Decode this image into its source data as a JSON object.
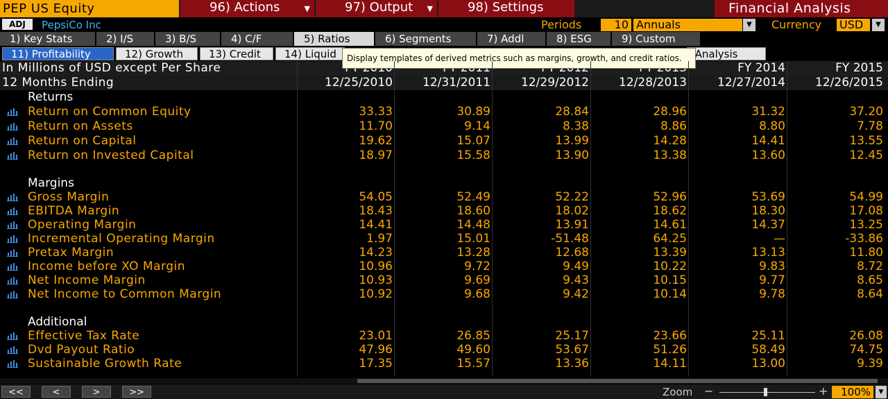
{
  "header": {
    "ticker": "PEP US Equity",
    "menu": [
      {
        "label": "96) Actions"
      },
      {
        "label": "97) Output"
      },
      {
        "label": "98) Settings"
      }
    ],
    "app_title": "Financial Analysis"
  },
  "subheader": {
    "adj": "ADJ",
    "company": "PepsiCo Inc",
    "periods_label": "Periods",
    "periods_value": "10",
    "period_type": "Annuals",
    "currency_label": "Currency",
    "currency_value": "USD"
  },
  "tabs": [
    {
      "label": "1) Key Stats"
    },
    {
      "label": "2) I/S"
    },
    {
      "label": "3) B/S"
    },
    {
      "label": "4) C/F"
    },
    {
      "label": "5) Ratios"
    },
    {
      "label": "6) Segments"
    },
    {
      "label": "7) Addl"
    },
    {
      "label": "8) ESG"
    },
    {
      "label": "9) Custom"
    }
  ],
  "subtabs": [
    {
      "label": "11) Profitability"
    },
    {
      "label": "12) Growth"
    },
    {
      "label": "13) Credit"
    },
    {
      "label": "14) Liquid"
    },
    {
      "label": "t Analysis"
    }
  ],
  "tooltip": "Display templates of derived metrics such as margins, growth, and credit ratios.",
  "table": {
    "units_label": "In Millions of USD except Per Share",
    "period_label": "12 Months Ending",
    "columns": [
      {
        "fy": "FY 2010",
        "date": "12/25/2010"
      },
      {
        "fy": "FY 2011",
        "date": "12/31/2011"
      },
      {
        "fy": "FY 2012",
        "date": "12/29/2012"
      },
      {
        "fy": "FY 2013",
        "date": "12/28/2013"
      },
      {
        "fy": "FY 2014",
        "date": "12/27/2014"
      },
      {
        "fy": "FY 2015",
        "date": "12/26/2015"
      }
    ],
    "sections": [
      {
        "title": "Returns",
        "rows": [
          {
            "label": "Return on Common Equity",
            "values": [
              "33.33",
              "30.89",
              "28.84",
              "28.96",
              "31.32",
              "37.20"
            ]
          },
          {
            "label": "Return on Assets",
            "values": [
              "11.70",
              "9.14",
              "8.38",
              "8.86",
              "8.80",
              "7.78"
            ]
          },
          {
            "label": "Return on Capital",
            "values": [
              "19.62",
              "15.07",
              "13.99",
              "14.28",
              "14.41",
              "13.55"
            ]
          },
          {
            "label": "Return on Invested Capital",
            "values": [
              "18.97",
              "15.58",
              "13.90",
              "13.38",
              "13.60",
              "12.45"
            ]
          }
        ]
      },
      {
        "title": "Margins",
        "rows": [
          {
            "label": "Gross Margin",
            "values": [
              "54.05",
              "52.49",
              "52.22",
              "52.96",
              "53.69",
              "54.99"
            ]
          },
          {
            "label": "EBITDA Margin",
            "values": [
              "18.43",
              "18.60",
              "18.02",
              "18.62",
              "18.30",
              "17.08"
            ]
          },
          {
            "label": "Operating Margin",
            "values": [
              "14.41",
              "14.48",
              "13.91",
              "14.61",
              "14.37",
              "13.25"
            ]
          },
          {
            "label": "Incremental Operating Margin",
            "values": [
              "1.97",
              "15.01",
              "-51.48",
              "64.25",
              "—",
              "-33.86"
            ]
          },
          {
            "label": "Pretax Margin",
            "values": [
              "14.23",
              "13.28",
              "12.68",
              "13.39",
              "13.13",
              "11.80"
            ]
          },
          {
            "label": "Income before XO Margin",
            "values": [
              "10.96",
              "9.72",
              "9.49",
              "10.22",
              "9.83",
              "8.72"
            ]
          },
          {
            "label": "Net Income Margin",
            "values": [
              "10.93",
              "9.69",
              "9.43",
              "10.15",
              "9.77",
              "8.65"
            ]
          },
          {
            "label": "Net Income to Common Margin",
            "values": [
              "10.92",
              "9.68",
              "9.42",
              "10.14",
              "9.78",
              "8.64"
            ]
          }
        ]
      },
      {
        "title": "Additional",
        "rows": [
          {
            "label": "Effective Tax Rate",
            "values": [
              "23.01",
              "26.85",
              "25.17",
              "23.66",
              "25.11",
              "26.08"
            ]
          },
          {
            "label": "Dvd Payout Ratio",
            "values": [
              "47.96",
              "49.60",
              "53.67",
              "51.26",
              "58.49",
              "74.75"
            ]
          },
          {
            "label": "Sustainable Growth Rate",
            "values": [
              "17.35",
              "15.57",
              "13.36",
              "14.11",
              "13.00",
              "9.39"
            ]
          }
        ]
      }
    ]
  },
  "footer": {
    "nav": [
      "<<",
      "<",
      ">",
      ">>"
    ],
    "zoom_label": "Zoom",
    "zoom_minus": "−",
    "zoom_plus": "+",
    "zoom_value": "100%"
  },
  "colors": {
    "accent": "#f7a800",
    "menu_red": "#8b0d14",
    "link_blue": "#3ab7f0",
    "tab_selected": "#2a66c8"
  }
}
